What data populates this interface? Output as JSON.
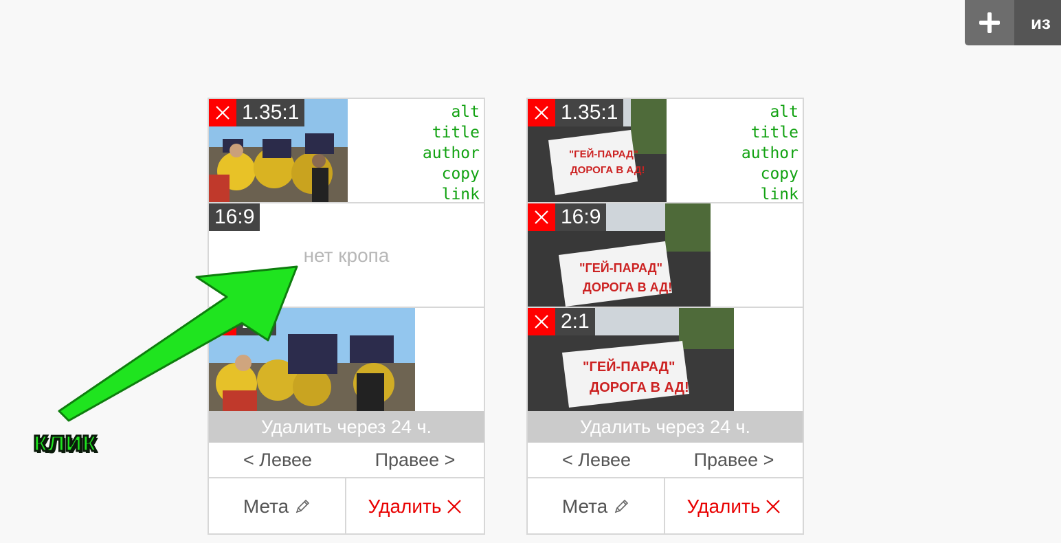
{
  "toolbar": {
    "add_icon": "plus-icon",
    "from_label": "из"
  },
  "cards": [
    {
      "crops": [
        {
          "ratio": "1.35:1",
          "has_image": true,
          "has_delete": true
        },
        {
          "ratio": "16:9",
          "has_image": false,
          "has_delete": false,
          "empty_text": "нет кропа"
        },
        {
          "ratio": "2:1",
          "has_image": true,
          "has_delete": true
        }
      ],
      "meta_links": [
        "alt",
        "title",
        "author",
        "copy",
        "link"
      ],
      "delete_notice": "Удалить через 24 ч.",
      "nav": {
        "left": "< Левее",
        "right": "Правее >"
      },
      "actions": {
        "meta": "Мета",
        "meta_icon": "pencil-icon",
        "delete": "Удалить",
        "delete_icon": "close-icon"
      }
    },
    {
      "crops": [
        {
          "ratio": "1.35:1",
          "has_image": true,
          "has_delete": true
        },
        {
          "ratio": "16:9",
          "has_image": true,
          "has_delete": true
        },
        {
          "ratio": "2:1",
          "has_image": true,
          "has_delete": true
        }
      ],
      "meta_links": [
        "alt",
        "title",
        "author",
        "copy",
        "link"
      ],
      "delete_notice": "Удалить через 24 ч.",
      "nav": {
        "left": "< Левее",
        "right": "Правее >"
      },
      "actions": {
        "meta": "Мета",
        "meta_icon": "pencil-icon",
        "delete": "Удалить",
        "delete_icon": "close-icon"
      }
    }
  ],
  "annotation": {
    "label": "клик",
    "color": "#1fe41f"
  },
  "colors": {
    "delete_red": "#ff0000",
    "link_green": "#12a212",
    "delete_text_red": "#e80000"
  }
}
